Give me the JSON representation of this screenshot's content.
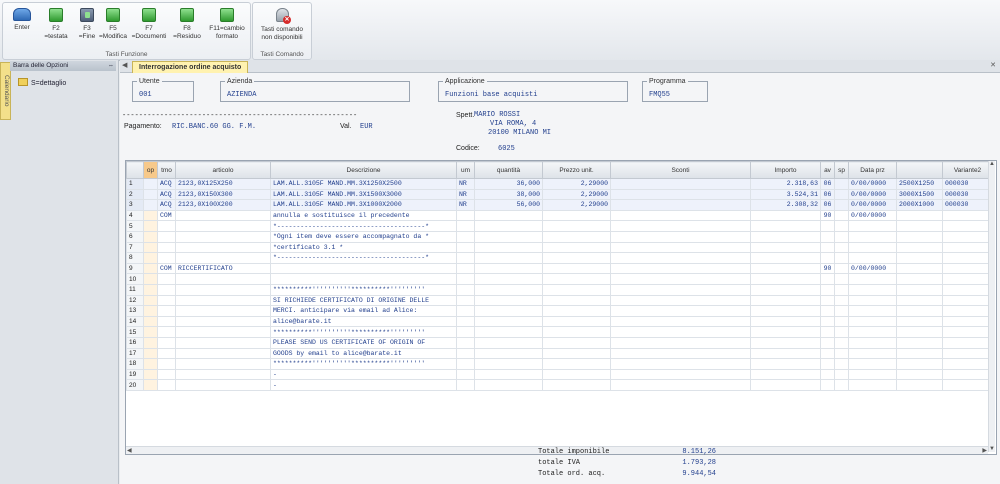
{
  "ribbon": {
    "buttons": [
      {
        "key": "Enter",
        "desc": ""
      },
      {
        "key": "F2",
        "desc": "=testata"
      },
      {
        "key": "F3",
        "desc": "=Fine"
      },
      {
        "key": "F5",
        "desc": "=Modifica"
      },
      {
        "key": "F7",
        "desc": "=Documenti"
      },
      {
        "key": "F8",
        "desc": "=Residuo"
      },
      {
        "key": "F11=cambio",
        "desc": "formato"
      }
    ],
    "group_fn_label": "Tasti Funzione",
    "cmd_button_line1": "Tasti comando",
    "cmd_button_line2": "non disponibili",
    "group_cmd_label": "Tasti Comando"
  },
  "sidebar": {
    "tab_label": "Calendario",
    "title": "Barra delle Opzioni",
    "pin": "⇔",
    "items": [
      {
        "label": "S=dettaglio"
      }
    ]
  },
  "tab": {
    "title": "Interrogazione ordine acquisto"
  },
  "header": {
    "utente_label": "Utente",
    "utente": "001",
    "azienda_label": "Azienda",
    "azienda": "AZIENDA",
    "applicazione_label": "Applicazione",
    "applicazione": "Funzioni base acquisti",
    "programma_label": "Programma",
    "programma": "FMQ55"
  },
  "doc": {
    "separator": "--------------------------------------------------------",
    "pagamento_label": "Pagamento:",
    "pagamento": "RIC.BANC.60 GG. F.M.",
    "valuta_label": "Val.",
    "valuta": "EUR",
    "spett_label": "Spett.",
    "address": [
      "MARIO ROSSI",
      "VIA ROMA, 4",
      "20100 MILANO MI"
    ],
    "codice_label": "Codice:",
    "codice": "6025"
  },
  "grid": {
    "columns": [
      "",
      "op",
      "tmo",
      "articolo",
      "Descrizione",
      "um",
      "quantità",
      "Prezzo unit.",
      "Sconti",
      "Importo",
      "av",
      "sp",
      "Data prz",
      "",
      "Variante2"
    ],
    "rows": [
      [
        "1",
        "",
        "ACQ",
        "2123,0X125X250",
        "LAM.ALL.3105F MAND.MM.3X1250X2500",
        "NR",
        "36,000",
        "2,29000",
        "",
        "2.318,63",
        "06",
        "",
        "0/00/0000",
        "2500X1250",
        "000030"
      ],
      [
        "2",
        "",
        "ACQ",
        "2123,0X150X300",
        "LAM.ALL.3105F MAND.MM.3X1500X3000",
        "NR",
        "38,000",
        "2,29000",
        "",
        "3.524,31",
        "06",
        "",
        "0/00/0000",
        "3000X1500",
        "000030"
      ],
      [
        "3",
        "",
        "ACQ",
        "2123,0X100X200",
        "LAM.ALL.3105F MAND.MM.3X1000X2000",
        "NR",
        "56,000",
        "2,29000",
        "",
        "2.308,32",
        "06",
        "",
        "0/00/0000",
        "2000X1000",
        "000030"
      ],
      [
        "4",
        "",
        "COM",
        "",
        "annulla e sostituisce il precedente",
        "",
        "",
        "",
        "",
        "",
        "90",
        "",
        "0/00/0000",
        "",
        ""
      ],
      [
        "5",
        "",
        "",
        "",
        "*--------------------------------------*",
        "",
        "",
        "",
        "",
        "",
        "",
        "",
        "",
        "",
        ""
      ],
      [
        "6",
        "",
        "",
        "",
        "*Ogni item deve essere accompagnato da *",
        "",
        "",
        "",
        "",
        "",
        "",
        "",
        "",
        "",
        ""
      ],
      [
        "7",
        "",
        "",
        "",
        "*certificato 3.1                      *",
        "",
        "",
        "",
        "",
        "",
        "",
        "",
        "",
        "",
        ""
      ],
      [
        "8",
        "",
        "",
        "",
        "*--------------------------------------*",
        "",
        "",
        "",
        "",
        "",
        "",
        "",
        "",
        "",
        ""
      ],
      [
        "9",
        "",
        "COM",
        "RICCERTIFICATO",
        "",
        "",
        "",
        "",
        "",
        "",
        "90",
        "",
        "0/00/0000",
        "",
        ""
      ],
      [
        "10",
        "",
        "",
        "",
        "",
        "",
        "",
        "",
        "",
        "",
        "",
        "",
        "",
        "",
        ""
      ],
      [
        "11",
        "",
        "",
        "",
        "**********''''''''''**********'''''''''",
        "",
        "",
        "",
        "",
        "",
        "",
        "",
        "",
        "",
        ""
      ],
      [
        "12",
        "",
        "",
        "",
        "SI RICHIEDE CERTIFICATO DI ORIGINE DELLE",
        "",
        "",
        "",
        "",
        "",
        "",
        "",
        "",
        "",
        ""
      ],
      [
        "13",
        "",
        "",
        "",
        "MERCI. anticipare via email ad Alice:",
        "",
        "",
        "",
        "",
        "",
        "",
        "",
        "",
        "",
        ""
      ],
      [
        "14",
        "",
        "",
        "",
        "alice@barate.it",
        "",
        "",
        "",
        "",
        "",
        "",
        "",
        "",
        "",
        ""
      ],
      [
        "15",
        "",
        "",
        "",
        "**********''''''''''**********'''''''''",
        "",
        "",
        "",
        "",
        "",
        "",
        "",
        "",
        "",
        ""
      ],
      [
        "16",
        "",
        "",
        "",
        "PLEASE SEND US CERTIFICATE OF ORIGIN OF",
        "",
        "",
        "",
        "",
        "",
        "",
        "",
        "",
        "",
        ""
      ],
      [
        "17",
        "",
        "",
        "",
        "GOODS by email to alice@barate.it",
        "",
        "",
        "",
        "",
        "",
        "",
        "",
        "",
        "",
        ""
      ],
      [
        "18",
        "",
        "",
        "",
        "**********''''''''''**********'''''''''",
        "",
        "",
        "",
        "",
        "",
        "",
        "",
        "",
        "",
        ""
      ],
      [
        "19",
        "",
        "",
        "",
        "-",
        "",
        "",
        "",
        "",
        "",
        "",
        "",
        "",
        "",
        ""
      ],
      [
        "20",
        "",
        "",
        "",
        "-",
        "",
        "",
        "",
        "",
        "",
        "",
        "",
        "",
        "",
        ""
      ]
    ]
  },
  "totals": {
    "imponibile_label": "Totale imponibile",
    "imponibile": "8.151,26",
    "iva_label": "totale IVA",
    "iva": "1.793,28",
    "ord_label": "Totale ord. acq.",
    "ord": "9.944,54"
  },
  "colors": {
    "accent_tab": "#fff2b0",
    "value_text": "#23408e",
    "op_column": "#f7c98a"
  }
}
